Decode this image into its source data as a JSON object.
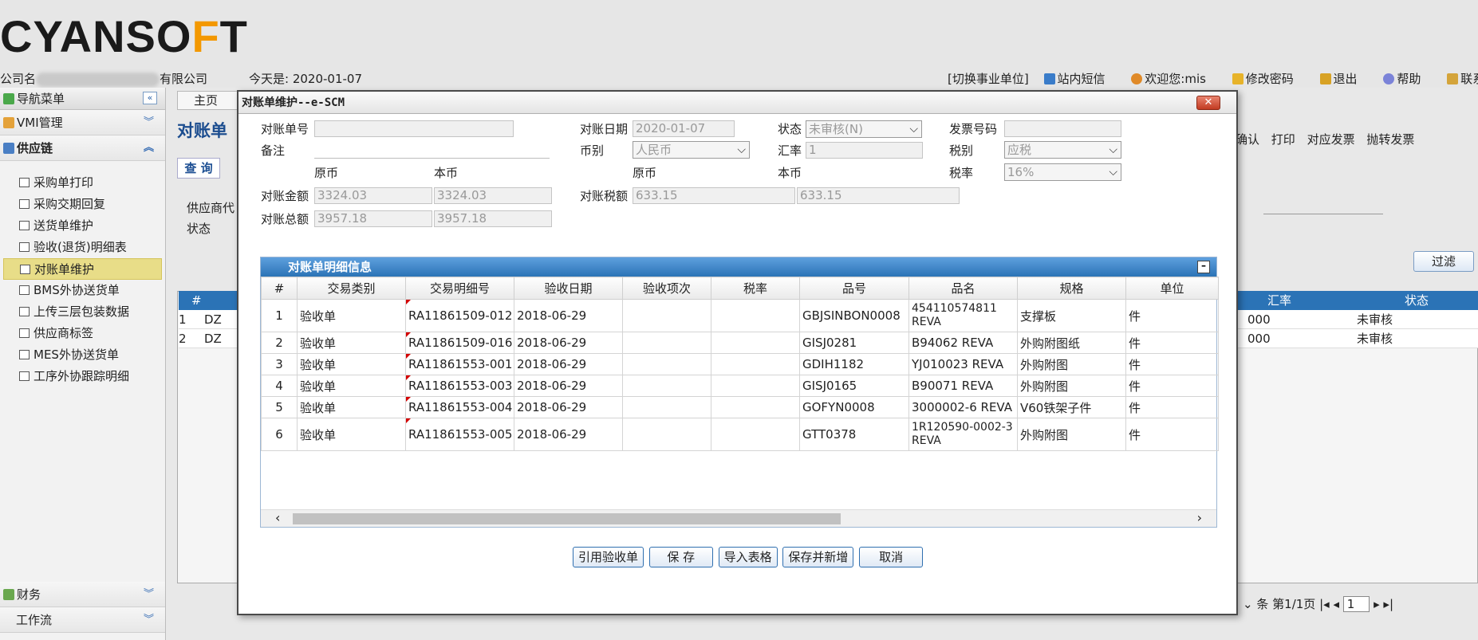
{
  "header": {
    "logo_main": "CYANSO",
    "logo_accent": "F",
    "logo_tail": "T",
    "company_prefix": "公司名",
    "company_suffix": "有限公司",
    "today": "今天是: 2020-01-07",
    "links": [
      "[切换事业单位]",
      "站内短信",
      "欢迎您:mis",
      "修改密码",
      "退出",
      "帮助",
      "联系我们"
    ]
  },
  "sidebar": {
    "title": "导航菜单",
    "sections": {
      "vmi": "VMI管理",
      "supply": "供应链"
    },
    "items": [
      "采购单打印",
      "采购交期回复",
      "送货单维护",
      "验收(退货)明细表",
      "对账单维护",
      "BMS外协送货单",
      "上传三层包装数据",
      "供应商标签",
      "MES外协送货单",
      "工序外协跟踪明细"
    ],
    "bottom": {
      "finance": "财务",
      "workflow": "工作流"
    }
  },
  "background": {
    "home_tab": "主页",
    "title": "对账单",
    "query_tab": "查 询",
    "label_supplier": "供应商代",
    "label_status": "状态",
    "toolbar": [
      "确认",
      "打印",
      "对应发票",
      "抛转发票"
    ],
    "filter": "过滤",
    "grid_head": [
      "#",
      "汇率",
      "状态"
    ],
    "rows": [
      {
        "n": "1",
        "code": "DZ",
        "rate": "000",
        "status": "未审核"
      },
      {
        "n": "2",
        "code": "DZ",
        "rate": "000",
        "status": "未审核"
      }
    ],
    "pager": {
      "unit": "条",
      "page_info": "第1/1页",
      "page": "1"
    }
  },
  "modal": {
    "title": "对账单维护--e-SCM",
    "close": "✕",
    "form": {
      "no_label": "对账单号",
      "no_value": "",
      "date_label": "对账日期",
      "date_value": "2020-01-07",
      "status_label": "状态",
      "status_value": "未审核(N)",
      "invoice_label": "发票号码",
      "invoice_value": "",
      "remark_label": "备注",
      "remark_value": "",
      "currency_label": "币别",
      "currency_value": "人民币",
      "rate_label": "汇率",
      "rate_value": "1",
      "taxtype_label": "税别",
      "taxtype_value": "应税",
      "orig_currency": "原币",
      "local_currency": "本币",
      "orig_currency2": "原币",
      "local_currency2": "本币",
      "taxrate_label": "税率",
      "taxrate_value": "16%",
      "amount_label": "对账金额",
      "amount_orig": "3324.03",
      "amount_local": "3324.03",
      "tax_label": "对账税额",
      "tax_orig": "633.15",
      "tax_local": "633.15",
      "total_label": "对账总额",
      "total_orig": "3957.18",
      "total_local": "3957.18"
    },
    "detail": {
      "title": "对账单明细信息",
      "columns": [
        "#",
        "交易类别",
        "交易明细号",
        "验收日期",
        "验收项次",
        "税率",
        "品号",
        "品名",
        "规格",
        "单位"
      ],
      "rows": [
        {
          "n": "1",
          "type": "验收单",
          "no": "RA11861509-012",
          "date": "2018-06-29",
          "item": "",
          "tax": "",
          "part": "GBJSINBON0008",
          "name": "454110574811 REVA",
          "spec": "支撑板",
          "unit": "件"
        },
        {
          "n": "2",
          "type": "验收单",
          "no": "RA11861509-016",
          "date": "2018-06-29",
          "item": "",
          "tax": "",
          "part": "GISJ0281",
          "name": "B94062 REVA",
          "spec": "外购附图纸",
          "unit": "件"
        },
        {
          "n": "3",
          "type": "验收单",
          "no": "RA11861553-001",
          "date": "2018-06-29",
          "item": "",
          "tax": "",
          "part": "GDIH1182",
          "name": "YJ010023 REVA",
          "spec": "外购附图",
          "unit": "件"
        },
        {
          "n": "4",
          "type": "验收单",
          "no": "RA11861553-003",
          "date": "2018-06-29",
          "item": "",
          "tax": "",
          "part": "GISJ0165",
          "name": "B90071 REVA",
          "spec": "外购附图",
          "unit": "件"
        },
        {
          "n": "5",
          "type": "验收单",
          "no": "RA11861553-004",
          "date": "2018-06-29",
          "item": "",
          "tax": "",
          "part": "GOFYN0008",
          "name": "3000002-6 REVA",
          "spec": "V60铁架子件",
          "unit": "件"
        },
        {
          "n": "6",
          "type": "验收单",
          "no": "RA11861553-005",
          "date": "2018-06-29",
          "item": "",
          "tax": "",
          "part": "GTT0378",
          "name": "1R120590-0002-3 REVA",
          "spec": "外购附图",
          "unit": "件"
        }
      ]
    },
    "buttons": [
      "引用验收单",
      "保 存",
      "导入表格",
      "保存并新增",
      "取消"
    ]
  }
}
